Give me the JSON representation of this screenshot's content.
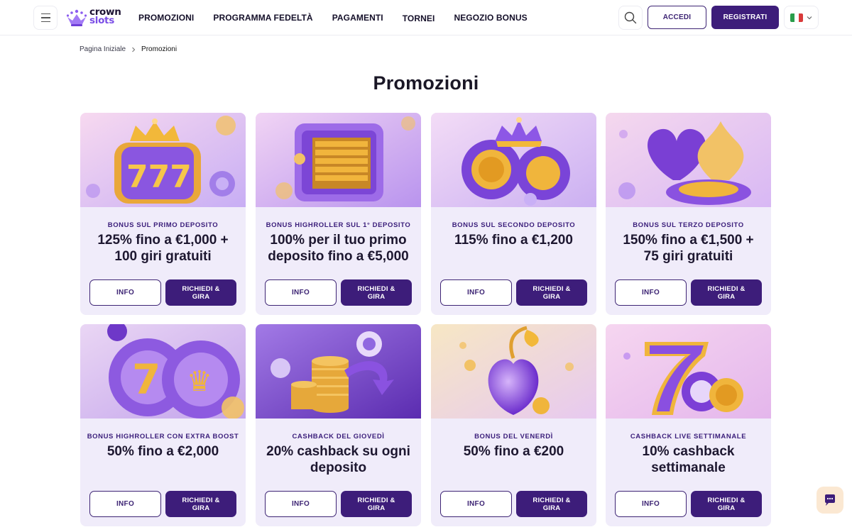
{
  "header": {
    "logo": {
      "line1": "crown",
      "line2": "slots"
    },
    "nav": [
      "PROMOZIONI",
      "PROGRAMMA FEDELTÀ",
      "PAGAMENTI",
      "TORNEI",
      "NEGOZIO BONUS"
    ],
    "login_label": "ACCEDI",
    "register_label": "REGISTRATI",
    "language": "it"
  },
  "breadcrumb": {
    "home": "Pagina Iniziale",
    "current": "Promozioni"
  },
  "page_title": "Promozioni",
  "colors": {
    "primary": "#3d1d7a",
    "card_bg": "#f0ecfa",
    "accent_purple": "#7a4de6",
    "gold": "#e6a83a"
  },
  "cards": [
    {
      "category": "BONUS SUL PRIMO DEPOSITO",
      "offer": "125% fino a €1,000 + 100 giri gratuiti",
      "info_label": "INFO",
      "claim_label": "RICHIEDI & GIRA",
      "image": "slot-777-crown"
    },
    {
      "category": "BONUS HIGHROLLER SUL 1° DEPOSITO",
      "offer": "100% per il tuo primo deposito fino a €5,000",
      "info_label": "INFO",
      "claim_label": "RICHIEDI & GIRA",
      "image": "vault-gold-bars"
    },
    {
      "category": "BONUS SUL SECONDO DEPOSITO",
      "offer": "115% fino a €1,200",
      "info_label": "INFO",
      "claim_label": "RICHIEDI & GIRA",
      "image": "crown-coins-chips"
    },
    {
      "category": "BONUS SUL TERZO DEPOSITO",
      "offer": "150% fino a €1,500 + 75 giri gratuiti",
      "info_label": "INFO",
      "claim_label": "RICHIEDI & GIRA",
      "image": "heart-spade-roulette"
    },
    {
      "category": "BONUS HIGHROLLER CON EXTRA BOOST",
      "offer": "50% fino a €2,000",
      "info_label": "INFO",
      "claim_label": "RICHIEDI & GIRA",
      "image": "seven-zero-reels"
    },
    {
      "category": "CASHBACK DEL GIOVEDÌ",
      "offer": "20% cashback su ogni deposito",
      "info_label": "INFO",
      "claim_label": "RICHIEDI & GIRA",
      "image": "coin-stacks-arrow"
    },
    {
      "category": "BONUS DEL VENERDÌ",
      "offer": "50% fino a €200",
      "info_label": "INFO",
      "claim_label": "RICHIEDI & GIRA",
      "image": "purple-cherry"
    },
    {
      "category": "CASHBACK LIVE SETTIMANALE",
      "offer": "10% cashback settimanale",
      "info_label": "INFO",
      "claim_label": "RICHIEDI & GIRA",
      "image": "seven-chips"
    }
  ]
}
